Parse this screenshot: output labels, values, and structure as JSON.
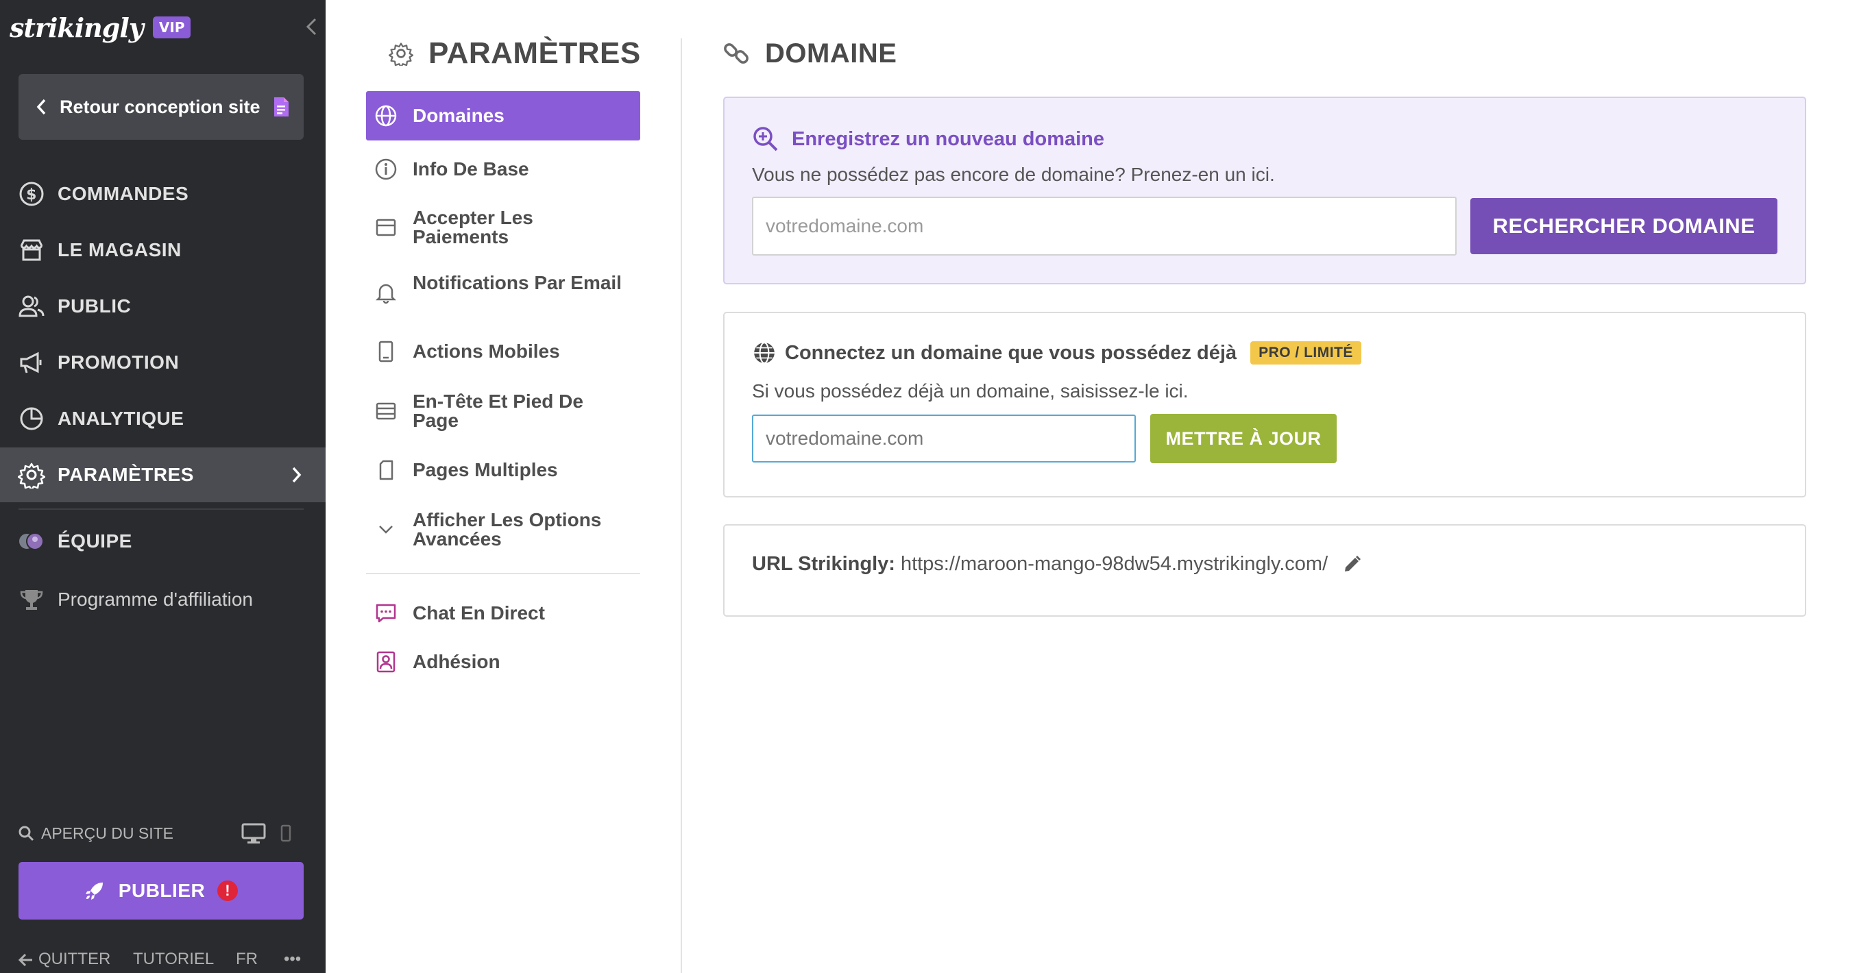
{
  "sidebar": {
    "logo": "strikingly",
    "vip_badge": "VIP",
    "back_button": "Retour conception site",
    "nav": [
      {
        "label": "COMMANDES",
        "icon": "dollar-circle-icon"
      },
      {
        "label": "LE MAGASIN",
        "icon": "store-icon"
      },
      {
        "label": "PUBLIC",
        "icon": "users-icon"
      },
      {
        "label": "PROMOTION",
        "icon": "megaphone-icon"
      },
      {
        "label": "ANALYTIQUE",
        "icon": "pie-chart-icon"
      },
      {
        "label": "PARAMÈTRES",
        "icon": "gear-icon",
        "active": true
      },
      {
        "label": "ÉQUIPE",
        "icon": "team-avatars-icon"
      },
      {
        "label": "Programme d'affiliation",
        "icon": "trophy-icon"
      }
    ],
    "preview_label": "APERÇU DU SITE",
    "publish_label": "PUBLIER",
    "publish_alert": "!",
    "footer": {
      "quit": "QUITTER",
      "tutorial": "TUTORIEL",
      "lang": "FR",
      "more": "•••"
    }
  },
  "settings": {
    "title": "PARAMÈTRES",
    "items": [
      {
        "label": "Domaines",
        "icon": "globe-icon",
        "active": true
      },
      {
        "label": "Info De Base",
        "icon": "info-icon"
      },
      {
        "label": "Accepter Les Paiements",
        "icon": "card-icon"
      },
      {
        "label": "Notifications Par Email",
        "icon": "bell-icon"
      },
      {
        "label": "Actions Mobiles",
        "icon": "mobile-icon"
      },
      {
        "label": "En-Tête Et Pied De Page",
        "icon": "header-footer-icon"
      },
      {
        "label": "Pages Multiples",
        "icon": "pages-icon"
      },
      {
        "label": "Afficher Les Options Avancées",
        "icon": "chevron-down-icon"
      },
      {
        "label": "Chat En Direct",
        "icon": "chat-icon"
      },
      {
        "label": "Adhésion",
        "icon": "member-icon"
      }
    ]
  },
  "main": {
    "title": "DOMAINE",
    "register": {
      "heading": "Enregistrez un nouveau domaine",
      "subtitle": "Vous ne possédez pas encore de domaine? Prenez-en un ici.",
      "placeholder": "votredomaine.com",
      "button": "RECHERCHER DOMAINE"
    },
    "connect": {
      "heading": "Connectez un domaine que vous possédez déjà",
      "badge": "PRO / LIMITÉ",
      "subtitle": "Si vous possédez déjà un domaine, saisissez-le ici.",
      "placeholder": "votredomaine.com",
      "button": "METTRE À JOUR"
    },
    "url": {
      "label": "URL Strikingly:",
      "value": "https://maroon-mango-98dw54.mystrikingly.com/"
    }
  },
  "colors": {
    "accent": "#8a5cd8",
    "sidebar_bg": "#2a2b2e",
    "green": "#9bb43a",
    "badge": "#f3c84a"
  }
}
